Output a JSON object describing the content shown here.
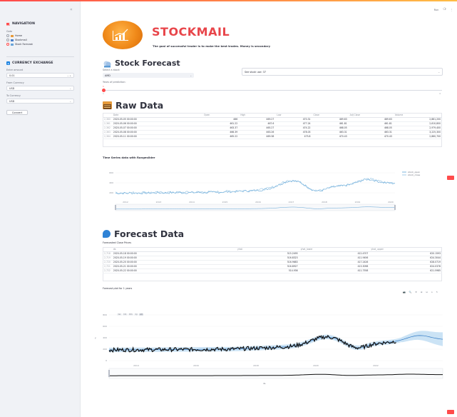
{
  "top_menu": {
    "share": "Run",
    "github": "❍",
    "menu": "⋮"
  },
  "sidebar": {
    "collapse": "«",
    "nav_title": "NAVIGATION",
    "goto_label": "Goto",
    "nav_items": [
      {
        "label": "Home",
        "icon": "home-icon",
        "selected": false
      },
      {
        "label": "Stockmail",
        "icon": "mail-icon",
        "selected": false
      },
      {
        "label": "Stock Forecast",
        "icon": "chart-icon",
        "selected": true
      }
    ],
    "currency_title": "CURRENCY EXCHANGE",
    "enter_amount_label": "Enter amount",
    "amount_value": "0.01",
    "from_label": "From Currency",
    "from_value": "USD",
    "to_label": "To Currency",
    "to_value": "USD",
    "convert_label": "Convert"
  },
  "brand": {
    "title": "STOCKMAIL",
    "subtitle": "The goal of successful trader is to make the best trades. Money is secondary"
  },
  "forecast_section": {
    "title": "Stock Forecast",
    "select_stock_label": "Select a stock",
    "select_stock_value": "AMD",
    "see_stock_value": "See stock use: 37",
    "years_label": "Years of prediction:",
    "years_value": "1",
    "years_min": "1",
    "years_max": "4"
  },
  "raw_data": {
    "title": "Raw Data",
    "columns": [
      "",
      "Date",
      "Open",
      "High",
      "Low",
      "Close",
      "Adj Close",
      "Volume"
    ],
    "rows": [
      [
        "2,360",
        "2020-05-05 00:00:00",
        "466",
        "469.27",
        "470.31",
        "469.63",
        "469.63",
        "2,881,200"
      ],
      [
        "2,361",
        "2020-05-06 00:00:00",
        "461.22",
        "467.6",
        "477.24",
        "461.81",
        "461.81",
        "2,610,800"
      ],
      [
        "2,362",
        "2020-05-07 00:00:00",
        "463.37",
        "465.27",
        "474.22",
        "468.05",
        "468.05",
        "2,979,400"
      ],
      [
        "2,363",
        "2020-05-08 00:00:00",
        "466.39",
        "463.26",
        "478.03",
        "463.31",
        "463.31",
        "3,225,300"
      ],
      [
        "2,364",
        "2020-05-11 00:00:00",
        "465.22",
        "469.38",
        "475.8",
        "470.43",
        "470.43",
        "2,860,700"
      ]
    ]
  },
  "time_series": {
    "title": "Time Series data with Rangeslider",
    "legend": [
      "stock_open",
      "stock_close"
    ],
    "ylabels": [
      "600",
      "400",
      "200"
    ],
    "xlabels": [
      "2012",
      "2013",
      "2014",
      "2015",
      "2016",
      "2017",
      "2018",
      "2019",
      "2020"
    ]
  },
  "forecast_data": {
    "title": "Forecast Data",
    "table_label": "Forecasted Close Prices",
    "columns": [
      "",
      "ds",
      "yhat",
      "yhat_lower",
      "yhat_upper"
    ],
    "rows": [
      [
        "2,718",
        "2020-05-18 00:00:00",
        "",
        "515.2495",
        "412.4707",
        "620.1593"
      ],
      [
        "2,719",
        "2020-05-19 00:00:00",
        "",
        "516.8323",
        "411.9456",
        "624.3044"
      ],
      [
        "2,720",
        "2020-05-20 00:00:00",
        "",
        "516.9683",
        "417.2426",
        "628.0719"
      ],
      [
        "2,721",
        "2020-05-21 00:00:00",
        "",
        "516.8927",
        "413.3098",
        "624.0378"
      ],
      [
        "2,722",
        "2020-05-22 00:00:00",
        "",
        "514.936",
        "411.7558",
        "621.5985"
      ]
    ],
    "plot_label": "Forecast plot for 1 years",
    "range_buttons": [
      "1w",
      "1m",
      "6m",
      "1y",
      "all"
    ],
    "active_range": "all",
    "ylabels": [
      "800",
      "600",
      "400",
      "200",
      "0"
    ],
    "ylabel": "y",
    "xlabels": [
      "2014",
      "2016",
      "2018",
      "2020",
      "2022"
    ],
    "xlabel": "ds",
    "modebar": "📷 🔍 ✥ ⊞ ⊟ ⌂ ↻"
  },
  "colors": {
    "accent": "#ff4b4b",
    "brand": "#e8454a",
    "forecast_band": "#a9d0ee",
    "series_open": "#5ea3d6",
    "series_close": "#8fc1e3"
  }
}
